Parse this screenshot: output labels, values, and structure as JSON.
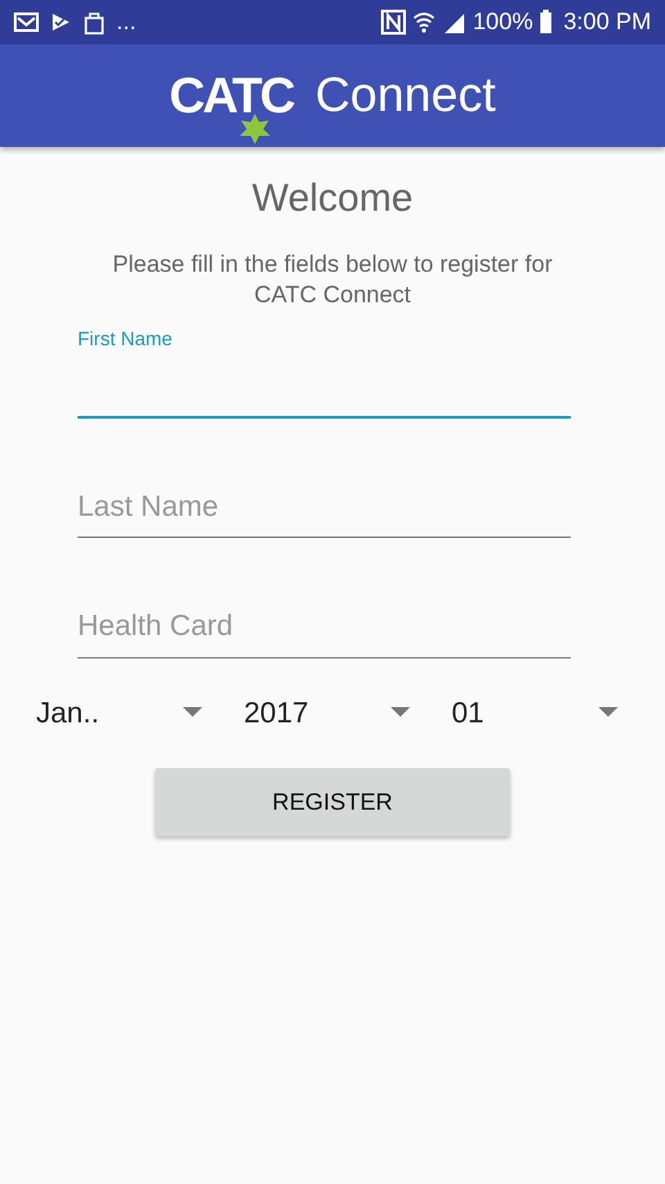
{
  "status_bar": {
    "overflow": "...",
    "battery": "100%",
    "time": "3:00 PM"
  },
  "app_bar": {
    "logo_text": "CATC",
    "title": "Connect"
  },
  "heading": "Welcome",
  "intro": "Please fill in the fields below to register for CATC Connect",
  "fields": [
    {
      "placeholder": "First Name",
      "focused": true
    },
    {
      "placeholder": "Last Name",
      "focused": false
    },
    {
      "placeholder": "Health Card",
      "focused": false
    }
  ],
  "spinners": [
    {
      "value": "Jan.."
    },
    {
      "value": "2017"
    },
    {
      "value": "01"
    }
  ],
  "button": "REGISTER"
}
